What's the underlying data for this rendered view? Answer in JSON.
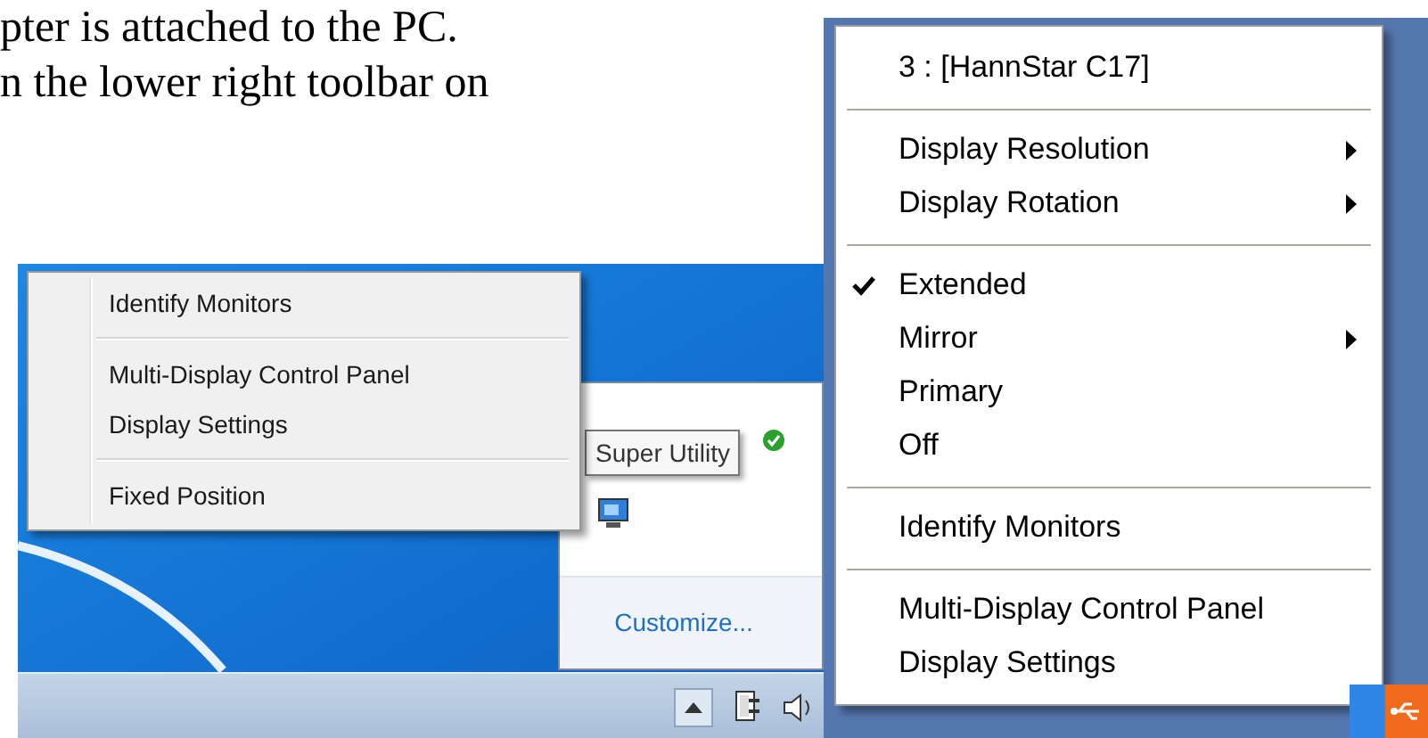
{
  "document_text": [
    "pter is attached to the PC.",
    "n the lower right toolbar on"
  ],
  "left_screenshot": {
    "menu": {
      "items": [
        {
          "kind": "item",
          "label": "Identify Monitors"
        },
        {
          "kind": "separator"
        },
        {
          "kind": "item",
          "label": "Multi-Display Control Panel"
        },
        {
          "kind": "item",
          "label": "Display Settings"
        },
        {
          "kind": "separator"
        },
        {
          "kind": "item",
          "label": "Fixed Position"
        }
      ]
    },
    "tooltip": "Super Utility",
    "tray_flyout": {
      "link": "Customize..."
    }
  },
  "right_screenshot": {
    "menu": {
      "items": [
        {
          "kind": "item",
          "label": "3 : [HannStar C17]",
          "checked": false,
          "submenu": false
        },
        {
          "kind": "separator"
        },
        {
          "kind": "item",
          "label": "Display Resolution",
          "checked": false,
          "submenu": true
        },
        {
          "kind": "item",
          "label": "Display Rotation",
          "checked": false,
          "submenu": true
        },
        {
          "kind": "separator"
        },
        {
          "kind": "item",
          "label": "Extended",
          "checked": true,
          "submenu": false
        },
        {
          "kind": "item",
          "label": "Mirror",
          "checked": false,
          "submenu": true
        },
        {
          "kind": "item",
          "label": "Primary",
          "checked": false,
          "submenu": false
        },
        {
          "kind": "item",
          "label": "Off",
          "checked": false,
          "submenu": false
        },
        {
          "kind": "separator"
        },
        {
          "kind": "item",
          "label": "Identify Monitors",
          "checked": false,
          "submenu": false
        },
        {
          "kind": "separator"
        },
        {
          "kind": "item",
          "label": "Multi-Display Control Panel",
          "checked": false,
          "submenu": false
        },
        {
          "kind": "item",
          "label": "Display Settings",
          "checked": false,
          "submenu": false
        }
      ]
    }
  }
}
